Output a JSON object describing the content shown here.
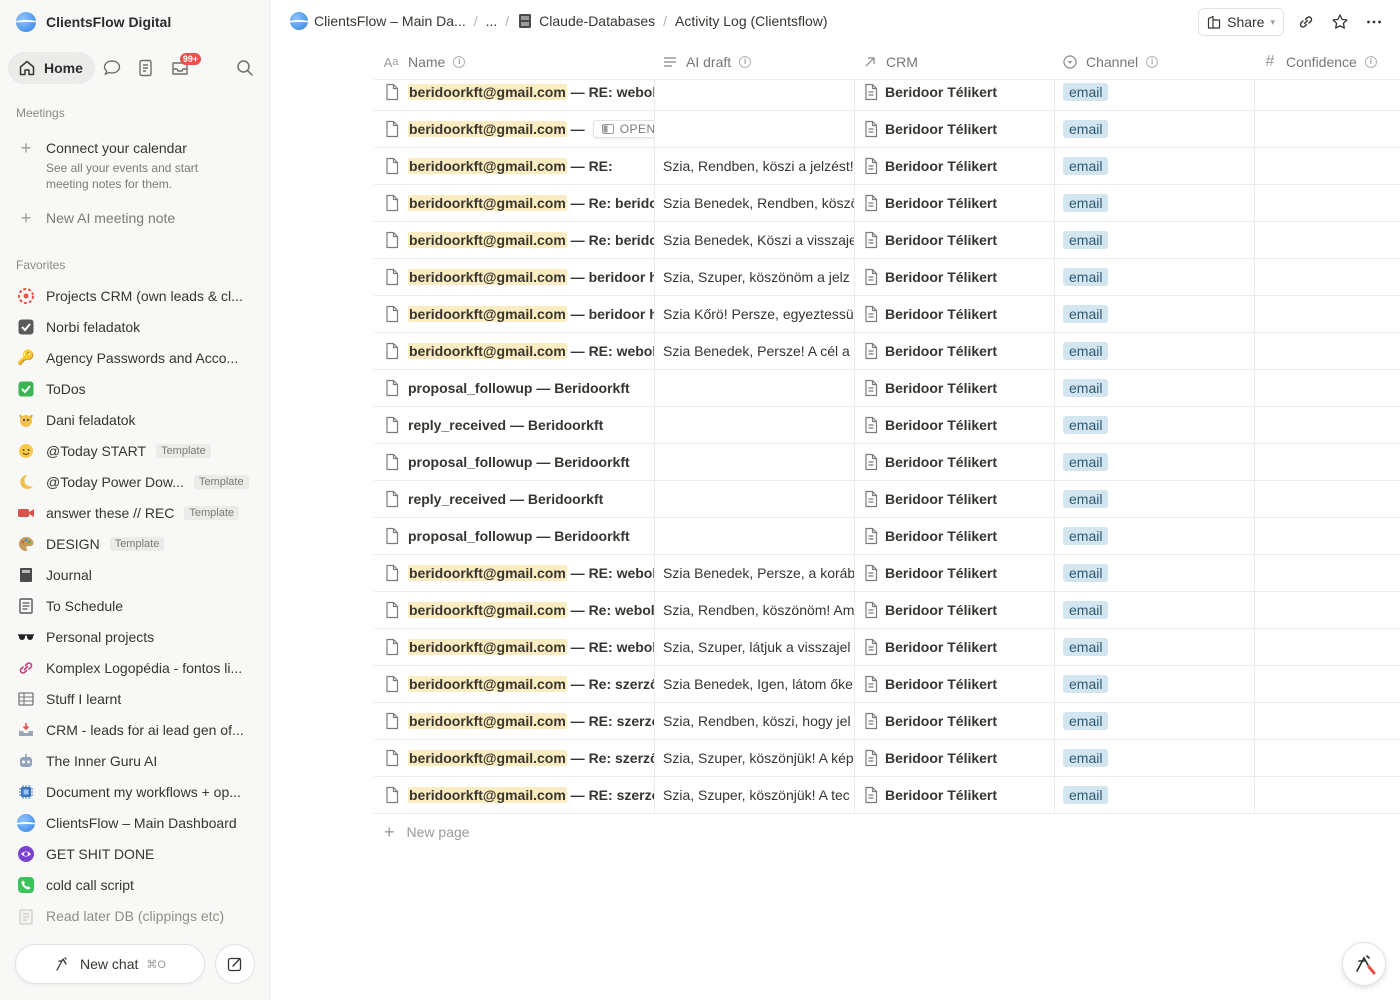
{
  "workspace": {
    "name": "ClientsFlow Digital"
  },
  "nav": {
    "home_label": "Home",
    "inbox_badge": "99+"
  },
  "meetings": {
    "heading": "Meetings",
    "connect_title": "Connect your calendar",
    "connect_desc_1": "See all your events and start",
    "connect_desc_2": "meeting notes for them.",
    "new_note": "New AI meeting note"
  },
  "favorites": {
    "heading": "Favorites",
    "items": [
      {
        "label": "Projects CRM (own leads & cl...",
        "icon": "target-icon"
      },
      {
        "label": "Norbi feladatok",
        "icon": "checkbox-icon"
      },
      {
        "label": "Agency Passwords and Acco...",
        "icon": "key-icon"
      },
      {
        "label": "ToDos",
        "icon": "check-mark-icon"
      },
      {
        "label": "Dani feladatok",
        "icon": "cat-icon"
      },
      {
        "label": "@Today START",
        "icon": "smile-icon",
        "tag": "Template"
      },
      {
        "label": "@Today Power Dow...",
        "icon": "moon-icon",
        "tag": "Template"
      },
      {
        "label": "answer these // REC",
        "icon": "video-camera-icon",
        "tag": "Template"
      },
      {
        "label": "DESIGN",
        "icon": "palette-icon",
        "tag": "Template"
      },
      {
        "label": "Journal",
        "icon": "notebook-icon"
      },
      {
        "label": "To Schedule",
        "icon": "schedule-list-icon"
      },
      {
        "label": "Personal projects",
        "icon": "sunglasses-icon"
      },
      {
        "label": "Komplex Logopédia - fontos li...",
        "icon": "link-icon"
      },
      {
        "label": "Stuff I learnt",
        "icon": "table-icon"
      },
      {
        "label": "CRM - leads for ai lead gen of...",
        "icon": "inbox-tray-icon"
      },
      {
        "label": "The Inner Guru AI",
        "icon": "robot-icon"
      },
      {
        "label": "Document my workflows + op...",
        "icon": "chip-icon"
      },
      {
        "label": "ClientsFlow – Main Dashboard",
        "icon": "globe-icon"
      },
      {
        "label": "GET SHIT DONE",
        "icon": "purple-circle-icon"
      },
      {
        "label": "cold call script",
        "icon": "phone-icon"
      },
      {
        "label": "Read later DB (clippings etc)",
        "icon": "clipboard-icon"
      }
    ]
  },
  "chat": {
    "label": "New chat",
    "shortcut": "⌘O"
  },
  "breadcrumbs": {
    "first": "ClientsFlow – Main Da...",
    "ellipsis": "...",
    "db": "Claude-Databases",
    "current": "Activity Log (Clientsflow)"
  },
  "topbar": {
    "share_label": "Share"
  },
  "table": {
    "columns": [
      {
        "label": "Name",
        "icon": "Aa"
      },
      {
        "label": "AI draft",
        "icon": "lines-icon"
      },
      {
        "label": "CRM",
        "icon": "relation-arrow-icon"
      },
      {
        "label": "Channel",
        "icon": "select-icon"
      },
      {
        "label": "Confidence",
        "icon": "#"
      }
    ],
    "open_label": "OPEN",
    "new_page": "New page",
    "rows": [
      {
        "email": "beridoorkft@gmail.com",
        "rest": " — RE: webold",
        "draft": "",
        "crm": "Beridoor Télikert",
        "channel": "email"
      },
      {
        "email": "beridoorkft@gmail.com",
        "rest": " — ",
        "draft": "",
        "crm": "Beridoor Télikert",
        "channel": "email",
        "hover": true
      },
      {
        "email": "beridoorkft@gmail.com",
        "rest": " — RE:",
        "draft": "Szia, Rendben, köszi a jelzést!",
        "crm": "Beridoor Télikert",
        "channel": "email"
      },
      {
        "email": "beridoorkft@gmail.com",
        "rest": " — Re: beridoor",
        "draft": "Szia Benedek, Rendben, köszö",
        "crm": "Beridoor Télikert",
        "channel": "email"
      },
      {
        "email": "beridoorkft@gmail.com",
        "rest": " — Re: beridoor",
        "draft": "Szia Benedek, Köszi a visszaje",
        "crm": "Beridoor Télikert",
        "channel": "email"
      },
      {
        "email": "beridoorkft@gmail.com",
        "rest": " — beridoor ho",
        "draft": "Szia, Szuper, köszönöm a jelz",
        "crm": "Beridoor Télikert",
        "channel": "email"
      },
      {
        "email": "beridoorkft@gmail.com",
        "rest": " — beridoor ho",
        "draft": "Szia Kőrö! Persze, egyeztessü",
        "crm": "Beridoor Télikert",
        "channel": "email"
      },
      {
        "email": "beridoorkft@gmail.com",
        "rest": " — RE: webold",
        "draft": "Szia Benedek, Persze! A cél a",
        "crm": "Beridoor Télikert",
        "channel": "email"
      },
      {
        "email": "",
        "rest": "proposal_followup — Beridoorkft",
        "draft": "",
        "crm": "Beridoor Télikert",
        "channel": "email"
      },
      {
        "email": "",
        "rest": "reply_received — Beridoorkft",
        "draft": "",
        "crm": "Beridoor Télikert",
        "channel": "email"
      },
      {
        "email": "",
        "rest": "proposal_followup — Beridoorkft",
        "draft": "",
        "crm": "Beridoor Télikert",
        "channel": "email"
      },
      {
        "email": "",
        "rest": "reply_received — Beridoorkft",
        "draft": "",
        "crm": "Beridoor Télikert",
        "channel": "email"
      },
      {
        "email": "",
        "rest": "proposal_followup — Beridoorkft",
        "draft": "",
        "crm": "Beridoor Télikert",
        "channel": "email"
      },
      {
        "email": "beridoorkft@gmail.com",
        "rest": " — RE: webold",
        "draft": "Szia Benedek, Persze, a koráb",
        "crm": "Beridoor Télikert",
        "channel": "email"
      },
      {
        "email": "beridoorkft@gmail.com",
        "rest": " — Re: webold",
        "draft": "Szia, Rendben, köszönöm! Am",
        "crm": "Beridoor Télikert",
        "channel": "email"
      },
      {
        "email": "beridoorkft@gmail.com",
        "rest": " — RE: webold",
        "draft": "Szia, Szuper, látjuk a visszajel",
        "crm": "Beridoor Télikert",
        "channel": "email"
      },
      {
        "email": "beridoorkft@gmail.com",
        "rest": " — Re: szerződ",
        "draft": "Szia Benedek, Igen, látom őke",
        "crm": "Beridoor Télikert",
        "channel": "email"
      },
      {
        "email": "beridoorkft@gmail.com",
        "rest": " — RE: szerződ",
        "draft": "Szia, Rendben, köszi, hogy jel",
        "crm": "Beridoor Télikert",
        "channel": "email"
      },
      {
        "email": "beridoorkft@gmail.com",
        "rest": " — Re: szerződ",
        "draft": "Szia, Szuper, köszönjük! A kép",
        "crm": "Beridoor Télikert",
        "channel": "email"
      },
      {
        "email": "beridoorkft@gmail.com",
        "rest": " — RE: szerződ",
        "draft": "Szia, Szuper, köszönjük! A tec",
        "crm": "Beridoor Télikert",
        "channel": "email"
      }
    ]
  }
}
